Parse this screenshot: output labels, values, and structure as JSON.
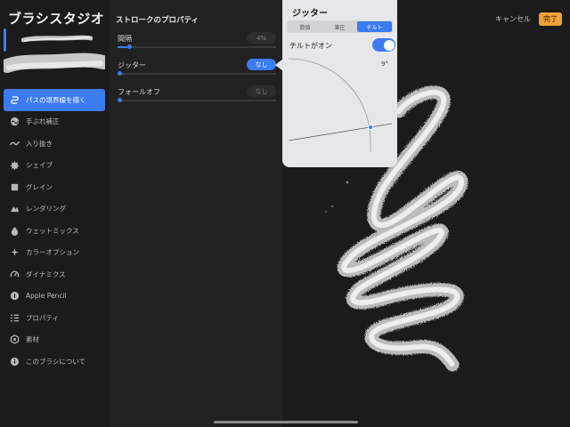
{
  "app": {
    "title": "ブラシスタジオ"
  },
  "sidebar": {
    "items": [
      {
        "label": "パスの境界線を描く",
        "icon": "path-icon",
        "active": true
      },
      {
        "label": "手ぶれ補正",
        "icon": "stabilization-icon",
        "active": false
      },
      {
        "label": "入り抜き",
        "icon": "taper-icon",
        "active": false
      },
      {
        "label": "シェイプ",
        "icon": "shape-icon",
        "active": false
      },
      {
        "label": "グレイン",
        "icon": "grain-icon",
        "active": false
      },
      {
        "label": "レンダリング",
        "icon": "rendering-icon",
        "active": false
      },
      {
        "label": "ウェットミックス",
        "icon": "wet-mix-icon",
        "active": false
      },
      {
        "label": "カラーオプション",
        "icon": "color-options-icon",
        "active": false
      },
      {
        "label": "ダイナミクス",
        "icon": "dynamics-icon",
        "active": false
      },
      {
        "label": "Apple Pencil",
        "icon": "apple-pencil-icon",
        "active": false
      },
      {
        "label": "プロパティ",
        "icon": "properties-icon",
        "active": false
      },
      {
        "label": "素材",
        "icon": "materials-icon",
        "active": false
      },
      {
        "label": "このブラシについて",
        "icon": "info-icon",
        "active": false
      }
    ]
  },
  "properties": {
    "title": "ストロークのプロパティ",
    "rows": [
      {
        "label": "間隔",
        "value": "4%",
        "level": 0.06,
        "highlighted": false
      },
      {
        "label": "ジッター",
        "value": "なし",
        "level": 0.0,
        "highlighted": true
      },
      {
        "label": "フォールオフ",
        "value": "なし",
        "level": 0.0,
        "highlighted": false
      }
    ]
  },
  "popover": {
    "title": "ジッター",
    "segments": [
      {
        "label": "数値",
        "active": false
      },
      {
        "label": "筆圧",
        "active": false
      },
      {
        "label": "チルト",
        "active": true
      }
    ],
    "tilt_label": "チルトがオン",
    "tilt_on": true,
    "tilt_degree": "9°"
  },
  "actions": {
    "cancel": "キャンセル",
    "done": "完了"
  },
  "colors": {
    "accent": "#3c7bf0",
    "done": "#f0a23a"
  }
}
